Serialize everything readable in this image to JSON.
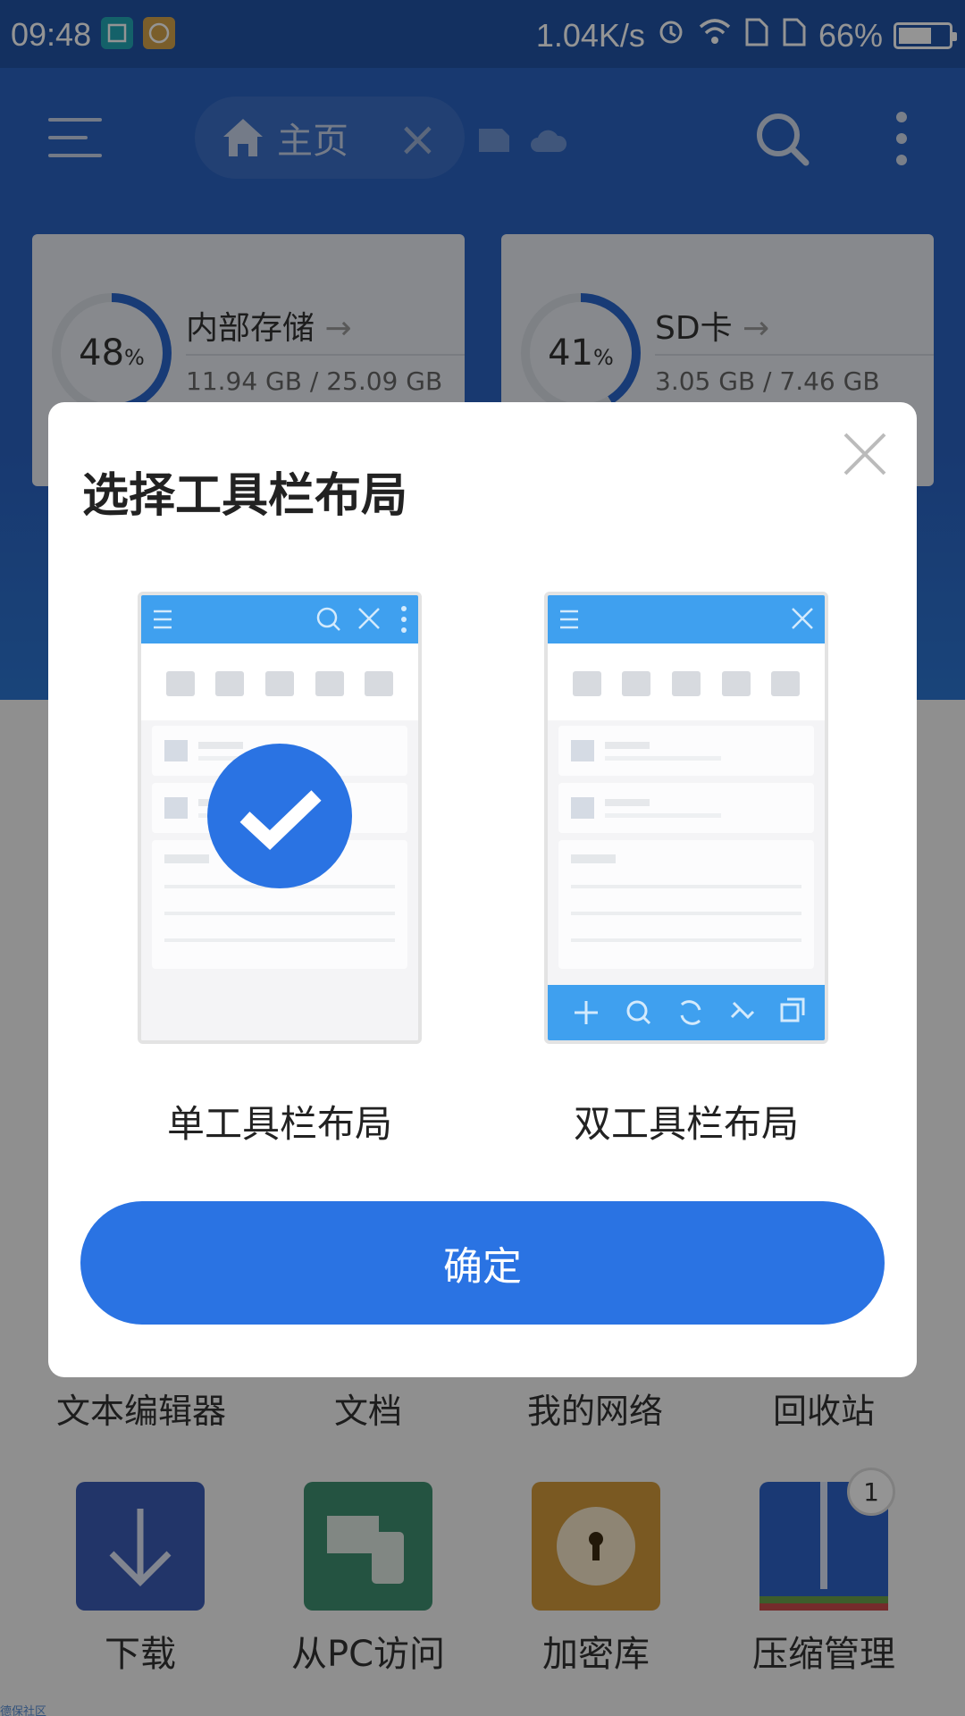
{
  "status_bar": {
    "time": "09:48",
    "net_speed": "1.04K/s",
    "battery": "66%",
    "battery_level": 0.66
  },
  "header": {
    "home_tab_label": "主页"
  },
  "storage": [
    {
      "name": "内部存储",
      "percent": "48",
      "percent_sign": "%",
      "usage": "11.94 GB / 25.09 GB",
      "fraction": 0.48
    },
    {
      "name": "SD卡",
      "percent": "41",
      "percent_sign": "%",
      "usage": "3.05 GB / 7.46 GB",
      "fraction": 0.41
    }
  ],
  "tools_row": [
    "文本编辑器",
    "文档",
    "我的网络",
    "回收站"
  ],
  "apps": [
    {
      "label": "下载",
      "color": "#3b5cb5"
    },
    {
      "label": "从PC访问",
      "color": "#3e8f70"
    },
    {
      "label": "加密库",
      "color": "#d39a3c"
    },
    {
      "label": "压缩管理",
      "color": "#2e62c8"
    }
  ],
  "badge_count": "1",
  "watermark": "德保社区",
  "dialog": {
    "title": "选择工具栏布局",
    "options": [
      {
        "label": "单工具栏布局",
        "selected": true
      },
      {
        "label": "双工具栏布局",
        "selected": false
      }
    ],
    "confirm_label": "确定"
  },
  "colors": {
    "accent": "#2a73e3",
    "header": "#2a62c2",
    "mock_toolbar": "#3fa0ef"
  }
}
